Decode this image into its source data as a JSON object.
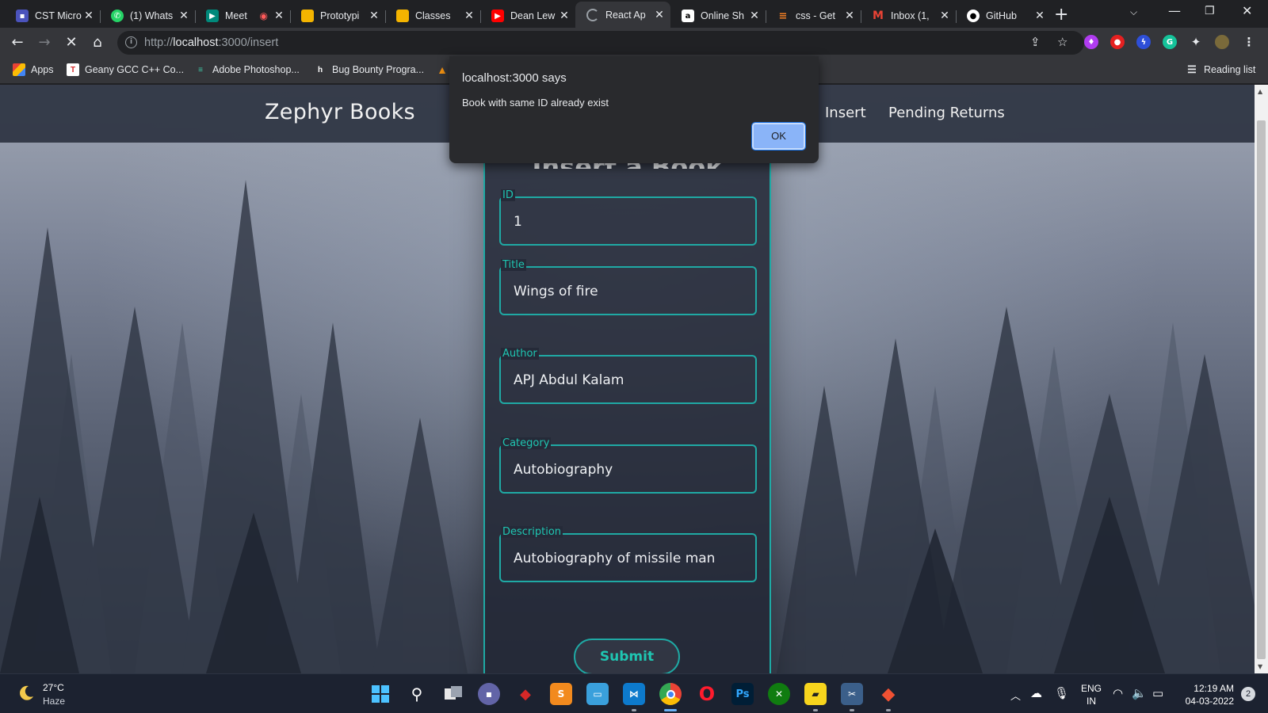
{
  "browser": {
    "tabs": [
      {
        "title": "CST Micro",
        "favicon": "teams-icon",
        "color": "#4b53bc"
      },
      {
        "title": "(1) Whats",
        "favicon": "whatsapp-icon",
        "color": "#25d366"
      },
      {
        "title": "Meet",
        "favicon": "meet-icon",
        "color": "#00897b"
      },
      {
        "title": "Prototypi",
        "favicon": "slides-icon",
        "color": "#f4b400"
      },
      {
        "title": "Classes",
        "favicon": "classroom-icon",
        "color": "#f4b400"
      },
      {
        "title": "Dean Lew",
        "favicon": "youtube-icon",
        "color": "#ff0000"
      },
      {
        "title": "React Ap",
        "favicon": "loading-icon",
        "color": "#9aa0a6",
        "active": true
      },
      {
        "title": "Online Sh",
        "favicon": "amazon-icon",
        "color": "#ffffff"
      },
      {
        "title": "css - Get",
        "favicon": "stackoverflow-icon",
        "color": "#f48024"
      },
      {
        "title": "Inbox (1,",
        "favicon": "gmail-icon",
        "color": "#ea4335"
      },
      {
        "title": "GitHub",
        "favicon": "github-icon",
        "color": "#ffffff"
      }
    ],
    "url": {
      "scheme": "http://",
      "host": "localhost",
      "rest": ":3000/insert"
    },
    "bookmarks": [
      {
        "label": "Apps",
        "icon": "apps-grid-icon"
      },
      {
        "label": "Geany GCC C++ Co...",
        "icon": "geany-icon"
      },
      {
        "label": "Adobe Photoshop...",
        "icon": "photoshop-bookmark-icon"
      },
      {
        "label": "Bug Bounty Progra...",
        "icon": "hackerone-icon"
      }
    ],
    "reading_list": "Reading list"
  },
  "app": {
    "brand": "Zephyr Books",
    "nav": [
      "Insert",
      "Pending Returns"
    ],
    "form_title": "Insert a Book",
    "fields": [
      {
        "legend": "ID",
        "value": "1"
      },
      {
        "legend": "Title",
        "value": "Wings of fire"
      },
      {
        "legend": "Author",
        "value": "APJ Abdul Kalam"
      },
      {
        "legend": "Category",
        "value": "Autobiography"
      },
      {
        "legend": "Description",
        "value": "Autobiography of missile man"
      }
    ],
    "submit_label": "Submit"
  },
  "dialog": {
    "title": "localhost:3000 says",
    "message": "Book with same ID already exist",
    "ok_label": "OK"
  },
  "taskbar": {
    "weather_temp": "27°C",
    "weather_desc": "Haze",
    "language": [
      "ENG",
      "IN"
    ],
    "time": "12:19 AM",
    "date": "04-03-2022",
    "notifications": "2"
  },
  "colors": {
    "accent": "#1fa9a4",
    "label": "#1fc6b2",
    "dialog_button": "#8ab4f8"
  }
}
